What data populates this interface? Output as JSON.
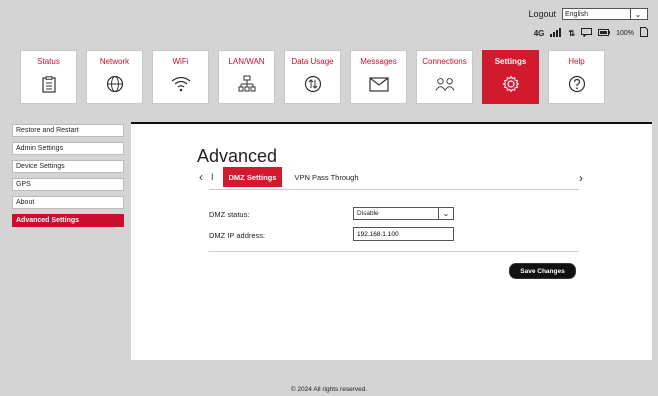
{
  "header": {
    "logout_label": "Logout",
    "language": {
      "selected": "English"
    },
    "status": {
      "network_type": "4G",
      "battery_text": "100%"
    }
  },
  "nav": {
    "items": [
      {
        "label": "Status",
        "icon": "clipboard-icon"
      },
      {
        "label": "Network",
        "icon": "globe-icon"
      },
      {
        "label": "WiFi",
        "icon": "wifi-icon"
      },
      {
        "label": "LAN/WAN",
        "icon": "lan-icon"
      },
      {
        "label": "Data Usage",
        "icon": "data-usage-icon"
      },
      {
        "label": "Messages",
        "icon": "envelope-icon"
      },
      {
        "label": "Connections",
        "icon": "users-icon"
      },
      {
        "label": "Settings",
        "icon": "gear-icon",
        "active": true
      },
      {
        "label": "Help",
        "icon": "help-icon"
      }
    ]
  },
  "sidebar": {
    "items": [
      {
        "label": "Restore and Restart"
      },
      {
        "label": "Admin Settings"
      },
      {
        "label": "Device Settings"
      },
      {
        "label": "GPS"
      },
      {
        "label": "About"
      },
      {
        "label": "Advanced Settings",
        "active": true
      }
    ]
  },
  "main": {
    "title": "Advanced",
    "tab_index_marker": "I",
    "tabs": [
      {
        "label": "DMZ Settings",
        "active": true
      },
      {
        "label": "VPN Pass Through"
      }
    ],
    "form": {
      "dmz_status_label": "DMZ status:",
      "dmz_status_value": "Disable",
      "dmz_ip_label": "DMZ IP address:",
      "dmz_ip_value": "192.168.1.100"
    },
    "save_label": "Save Changes"
  },
  "footer": {
    "text": "© 2024 All rights reserved."
  },
  "colors": {
    "accent": "#d21a2e",
    "background": "#d4d4d4"
  }
}
